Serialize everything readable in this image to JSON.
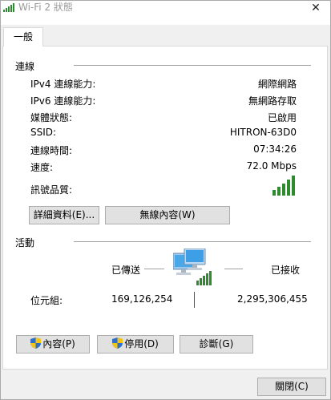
{
  "window": {
    "title": "Wi-Fi 2 狀態",
    "close_glyph": "✕"
  },
  "tab": {
    "label": "一般"
  },
  "connection": {
    "section_label": "連線",
    "rows": [
      {
        "label": "IPv4 連線能力:",
        "value": "網際網路"
      },
      {
        "label": "IPv6 連線能力:",
        "value": "無網路存取"
      },
      {
        "label": "媒體狀態:",
        "value": "已啟用"
      },
      {
        "label": "SSID:",
        "value": "HITRON-63D0"
      },
      {
        "label": "連線時間:",
        "value": "07:34:26"
      },
      {
        "label": "速度:",
        "value": "72.0 Mbps"
      },
      {
        "label": "訊號品質:",
        "value": ""
      }
    ],
    "signal_icon": "signal-strength-full-icon",
    "details_button": "詳細資料(E)...",
    "wireless_props_button": "無線內容(W)"
  },
  "activity": {
    "section_label": "活動",
    "sent_label": "已傳送",
    "received_label": "已接收",
    "bytes_label": "位元組:",
    "sent_value": "169,126,254",
    "received_value": "2,295,306,455",
    "network_icon": "network-computers-icon"
  },
  "buttons": {
    "properties": "內容(P)",
    "disable": "停用(D)",
    "diagnose": "診斷(G)",
    "close": "關閉(C)"
  },
  "colors": {
    "signal_green": "#2e8b2e",
    "shield_blue": "#2f6fc9",
    "shield_yellow": "#f3c316"
  }
}
